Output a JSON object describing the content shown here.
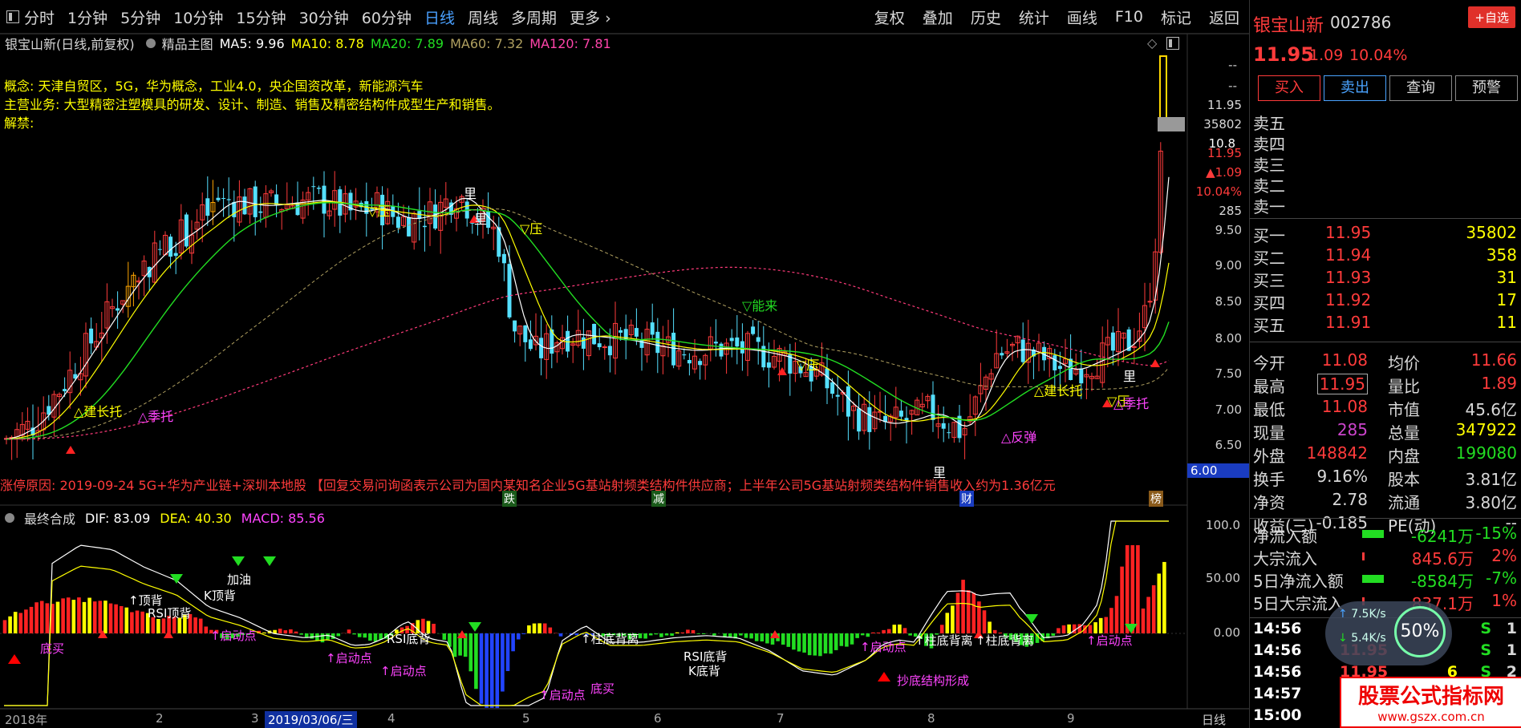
{
  "toolbar": {
    "items": [
      "分时",
      "1分钟",
      "5分钟",
      "10分钟",
      "15分钟",
      "30分钟",
      "60分钟",
      "日线",
      "周线",
      "多周期",
      "更多"
    ],
    "active": "日线",
    "more_arrow": "›"
  },
  "right_toolbar": {
    "items": [
      "复权",
      "叠加",
      "历史",
      "统计",
      "画线",
      "F10",
      "标记",
      "返回"
    ]
  },
  "ma_line": {
    "title": "银宝山新(日线,前复权)",
    "template": "精品主图",
    "ma5": "MA5: 9.96",
    "ma10": "MA10: 8.78",
    "ma20": "MA20: 7.89",
    "ma60": "MA60: 7.32",
    "ma120": "MA120: 7.81"
  },
  "info": {
    "concept": "概念:  天津自贸区，5G，华为概念，工业4.0，央企国资改革，新能源汽车",
    "business": "主营业务:  大型精密注塑模具的研发、设计、制造、销售及精密结构件成型生产和销售。",
    "unlock": "解禁:"
  },
  "zt_reason": "涨停原因:     2019-09-24 5G+华为产业链+深圳本地股 【回复交易问询函表示公司为国内某知名企业5G基站射频类结构件供应商；上半年公司5G基站射频类结构件销售收入约为1.36亿元",
  "macd": {
    "title": "最终合成",
    "dif": "DIF: 83.09",
    "dea": "DEA: 40.30",
    "macd": "MACD: 85.56"
  },
  "price_axis": [
    "11.95",
    "35802",
    "11.95",
    "▲1.09",
    "10.04%",
    "285",
    "9.50",
    "9.00",
    "8.50",
    "8.00",
    "7.50",
    "7.00",
    "6.50",
    "6.00"
  ],
  "price_axis_top": [
    "--",
    "--"
  ],
  "hover_price": "10.8",
  "macd_axis": [
    "100.0",
    "50.00",
    "0.00"
  ],
  "xaxis": {
    "ticks": [
      "2018年",
      "2",
      "3",
      "2019/03/06/三",
      "4",
      "5",
      "6",
      "7",
      "8",
      "9",
      "日线"
    ]
  },
  "event_labels": {
    "die": "跌",
    "jian": "减",
    "cai": "财",
    "bang": "榜"
  },
  "chart_annotations": [
    "▽压",
    "▽压",
    "▽压",
    "▽能来",
    "▽压",
    "△季托",
    "△季托",
    "△建长托",
    "△建长托",
    "△反弹",
    "里",
    "里",
    "里",
    "里"
  ],
  "macd_annotations": [
    "底买",
    "↑启动点",
    "↑顶背",
    "K顶背",
    "RSI顶背",
    "加油",
    "↑启动点",
    "↑柱底背离",
    "RSI底背",
    "↑启动点",
    "RSI底背",
    "K底背",
    "↑启动点",
    "↑启动点",
    "↑柱底背离",
    "↑柱底背离",
    "底买",
    "抄底结构形成",
    "↑启动点"
  ],
  "stock": {
    "name": "银宝山新",
    "code": "002786",
    "price": "11.95",
    "change": "1.09",
    "pct": "10.04%",
    "add_btn": "+自选"
  },
  "trade_buttons": [
    "买入",
    "卖出",
    "查询",
    "预警"
  ],
  "sell_book": [
    {
      "label": "卖五"
    },
    {
      "label": "卖四"
    },
    {
      "label": "卖三"
    },
    {
      "label": "卖二"
    },
    {
      "label": "卖一"
    }
  ],
  "buy_book": [
    {
      "label": "买一",
      "price": "11.95",
      "vol": "35802"
    },
    {
      "label": "买二",
      "price": "11.94",
      "vol": "358"
    },
    {
      "label": "买三",
      "price": "11.93",
      "vol": "31"
    },
    {
      "label": "买四",
      "price": "11.92",
      "vol": "17"
    },
    {
      "label": "买五",
      "price": "11.91",
      "vol": "11"
    }
  ],
  "stats": [
    {
      "l1": "今开",
      "v1": "11.08",
      "c1": "#ff3b3b",
      "l2": "均价",
      "v2": "11.66",
      "c2": "#ff3b3b"
    },
    {
      "l1": "最高",
      "v1": "11.95",
      "c1": "#ff3b3b",
      "l2": "量比",
      "v2": "1.89",
      "c2": "#ff3b3b"
    },
    {
      "l1": "最低",
      "v1": "11.08",
      "c1": "#ff3b3b",
      "l2": "市值",
      "v2": "45.6亿",
      "c2": "#d8d8d8"
    },
    {
      "l1": "现量",
      "v1": "285",
      "c1": "#cc44cc",
      "l2": "总量",
      "v2": "347922",
      "c2": "#ffff00"
    },
    {
      "l1": "外盘",
      "v1": "148842",
      "c1": "#ff3b3b",
      "l2": "内盘",
      "v2": "199080",
      "c2": "#22dd22"
    },
    {
      "l1": "换手",
      "v1": "9.16%",
      "c1": "#d8d8d8",
      "l2": "股本",
      "v2": "3.81亿",
      "c2": "#d8d8d8"
    },
    {
      "l1": "净资",
      "v1": "2.78",
      "c1": "#d8d8d8",
      "l2": "流通",
      "v2": "3.80亿",
      "c2": "#d8d8d8"
    },
    {
      "l1": "收益(三)",
      "v1": "-0.185",
      "c1": "#d8d8d8",
      "l2": "PE(动)",
      "v2": "--",
      "c2": "#d8d8d8"
    }
  ],
  "flows": [
    {
      "label": "净流入额",
      "value": "-6241万",
      "pct": "-15%",
      "color": "#22dd22",
      "bar": 0.9
    },
    {
      "label": "大宗流入",
      "value": "845.6万",
      "pct": "2%",
      "color": "#ff3b3b",
      "bar": 0.1
    },
    {
      "label": "5日净流入额",
      "value": "-8584万",
      "pct": "-7%",
      "color": "#22dd22",
      "bar": 0.9
    },
    {
      "label": "5日大宗流入",
      "value": "837.1万",
      "pct": "1%",
      "color": "#ff3b3b",
      "bar": 0.08
    }
  ],
  "ticks": [
    {
      "time": "14:56",
      "price": "",
      "vol": "",
      "flag": "S",
      "n": "1"
    },
    {
      "time": "14:56",
      "price": "11.95",
      "vol": "",
      "flag": "S",
      "n": "1"
    },
    {
      "time": "14:56",
      "price": "11.95",
      "vol": "6",
      "flag": "S",
      "n": "2"
    },
    {
      "time": "14:57",
      "price": "",
      "vol": "",
      "flag": "",
      "n": ""
    },
    {
      "time": "15:00",
      "price": "",
      "vol": "",
      "flag": "",
      "n": ""
    }
  ],
  "speed": {
    "up": "7.5K/s",
    "down": "5.4K/s",
    "pct": "50%"
  },
  "watermark": {
    "line1": "股票公式指标网",
    "line2": "www.gszx.com.cn"
  }
}
